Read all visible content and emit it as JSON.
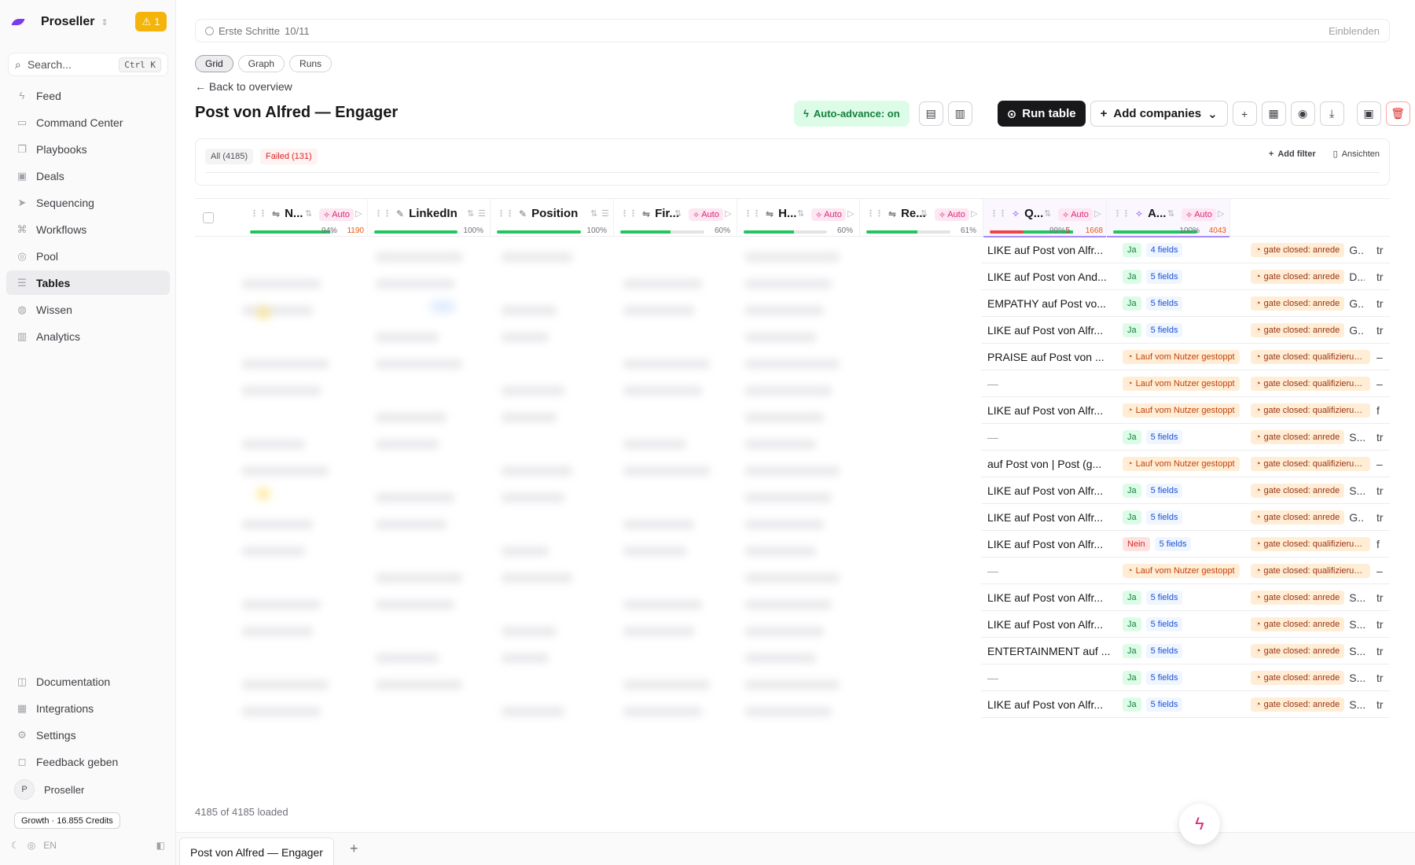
{
  "app": {
    "name": "Proseller",
    "alert_count": "1",
    "search_placeholder": "Search...",
    "search_shortcut": "Ctrl K"
  },
  "nav": [
    {
      "label": "Feed",
      "icon": "lightning-icon",
      "glyph": "ϟ"
    },
    {
      "label": "Command Center",
      "icon": "chat-icon",
      "glyph": "▭"
    },
    {
      "label": "Playbooks",
      "icon": "book-icon",
      "glyph": "❐"
    },
    {
      "label": "Deals",
      "icon": "briefcase-icon",
      "glyph": "▣"
    },
    {
      "label": "Sequencing",
      "icon": "send-icon",
      "glyph": "➤"
    },
    {
      "label": "Workflows",
      "icon": "workflow-icon",
      "glyph": "⌘"
    },
    {
      "label": "Pool",
      "icon": "globe-icon",
      "glyph": "◎"
    },
    {
      "label": "Tables",
      "icon": "database-icon",
      "glyph": "☰",
      "active": true
    },
    {
      "label": "Wissen",
      "icon": "knowledge-icon",
      "glyph": "◍"
    },
    {
      "label": "Analytics",
      "icon": "chart-icon",
      "glyph": "▥"
    }
  ],
  "nav_bottom": [
    {
      "label": "Documentation",
      "icon": "doc-icon",
      "glyph": "◫"
    },
    {
      "label": "Integrations",
      "icon": "puzzle-icon",
      "glyph": "▦"
    },
    {
      "label": "Settings",
      "icon": "gear-icon",
      "glyph": "⚙"
    },
    {
      "label": "Feedback geben",
      "icon": "message-icon",
      "glyph": "◻"
    }
  ],
  "user": {
    "initial": "P",
    "name": "Proseller",
    "credits": "Growth · 16.855 Credits",
    "language": "EN"
  },
  "onboarding": {
    "label": "Erste Schritte",
    "progress": "10/11",
    "action": "Einblenden"
  },
  "view_tabs": [
    "Grid",
    "Graph",
    "Runs"
  ],
  "back_label": "Back to overview",
  "page_title": "Post von Alfred — Engager",
  "toolbar": {
    "auto_advance": "Auto-advance: on",
    "run_table": "Run table",
    "add_companies": "Add companies"
  },
  "filters": {
    "all": "All (4185)",
    "failed": "Failed (131)",
    "add_filter": "Add filter",
    "views": "Ansichten"
  },
  "columns": [
    {
      "name": "N...",
      "kind": "formula",
      "auto": "Auto",
      "progress": 0.94,
      "pct": "94%",
      "orange": "1190"
    },
    {
      "name": "LinkedIn",
      "kind": "edit",
      "progress": 1.0,
      "pct": "100%"
    },
    {
      "name": "Position",
      "kind": "edit",
      "progress": 1.0,
      "pct": "100%"
    },
    {
      "name": "Fir...",
      "kind": "formula",
      "auto": "Auto",
      "progress": 0.6,
      "pct": "60%"
    },
    {
      "name": "H...",
      "kind": "formula",
      "auto": "Auto",
      "progress": 0.6,
      "pct": "60%"
    },
    {
      "name": "Re...",
      "kind": "formula",
      "auto": "Auto",
      "progress": 0.61,
      "pct": "61%"
    },
    {
      "name": "Q...",
      "kind": "ai",
      "auto": "Auto",
      "progress": 0.99,
      "pct": "99%",
      "red": "5",
      "orange": "1668"
    },
    {
      "name": "A...",
      "kind": "ai",
      "auto": "Auto",
      "progress": 1.0,
      "pct": "100%",
      "orange": "4043"
    }
  ],
  "rows": [
    {
      "re": "LIKE auf Post von Alfr...",
      "q": "Ja",
      "fields": "4 fields",
      "gate": "gate closed: anrede",
      "a": "G...",
      "n": "tr"
    },
    {
      "re": "LIKE auf Post von And...",
      "q": "Ja",
      "fields": "5 fields",
      "gate": "gate closed: anrede",
      "a": "D...",
      "n": "tr"
    },
    {
      "re": "EMPATHY auf Post vo...",
      "q": "Ja",
      "fields": "5 fields",
      "gate": "gate closed: anrede",
      "a": "G...",
      "n": "tr"
    },
    {
      "re": "LIKE auf Post von Alfr...",
      "q": "Ja",
      "fields": "5 fields",
      "gate": "gate closed: anrede",
      "a": "G...",
      "n": "tr"
    },
    {
      "re": "PRAISE auf Post von ...",
      "warn": "Lauf vom Nutzer gestoppt",
      "gate": "gate closed: qualifizierung...",
      "n": "–"
    },
    {
      "re": "—",
      "warn": "Lauf vom Nutzer gestoppt",
      "gate": "gate closed: qualifizierung...",
      "n": "–"
    },
    {
      "re": "LIKE auf Post von Alfr...",
      "warn": "Lauf vom Nutzer gestoppt",
      "gate": "gate closed: qualifizierung...",
      "n": "f"
    },
    {
      "re": "—",
      "q": "Ja",
      "fields": "5 fields",
      "gate": "gate closed: anrede",
      "a": "S...",
      "n": "tr"
    },
    {
      "re": "auf Post von | Post (g...",
      "warn": "Lauf vom Nutzer gestoppt",
      "gate": "gate closed: qualifizierung...",
      "n": "–"
    },
    {
      "re": "LIKE auf Post von Alfr...",
      "q": "Ja",
      "fields": "5 fields",
      "gate": "gate closed: anrede",
      "a": "S...",
      "n": "tr"
    },
    {
      "re": "LIKE auf Post von Alfr...",
      "q": "Ja",
      "fields": "5 fields",
      "gate": "gate closed: anrede",
      "a": "G...",
      "n": "tr"
    },
    {
      "re": "LIKE auf Post von Alfr...",
      "q": "Nein",
      "fields": "5 fields",
      "gate": "gate closed: qualifizierung...",
      "n": "f"
    },
    {
      "re": "—",
      "warn": "Lauf vom Nutzer gestoppt",
      "gate": "gate closed: qualifizierung...",
      "n": "–"
    },
    {
      "re": "LIKE auf Post von Alfr...",
      "q": "Ja",
      "fields": "5 fields",
      "gate": "gate closed: anrede",
      "a": "S...",
      "n": "tr"
    },
    {
      "re": "LIKE auf Post von Alfr...",
      "q": "Ja",
      "fields": "5 fields",
      "gate": "gate closed: anrede",
      "a": "S...",
      "n": "tr"
    },
    {
      "re": "ENTERTAINMENT auf ...",
      "q": "Ja",
      "fields": "5 fields",
      "gate": "gate closed: anrede",
      "a": "S...",
      "n": "tr"
    },
    {
      "re": "—",
      "q": "Ja",
      "fields": "5 fields",
      "gate": "gate closed: anrede",
      "a": "S...",
      "n": "tr"
    },
    {
      "re": "LIKE auf Post von Alfr...",
      "q": "Ja",
      "fields": "5 fields",
      "gate": "gate closed: anrede",
      "a": "S...",
      "n": "tr"
    }
  ],
  "footer": {
    "loaded": "4185 of 4185 loaded",
    "sheet_tab": "Post von Alfred — Engager"
  }
}
